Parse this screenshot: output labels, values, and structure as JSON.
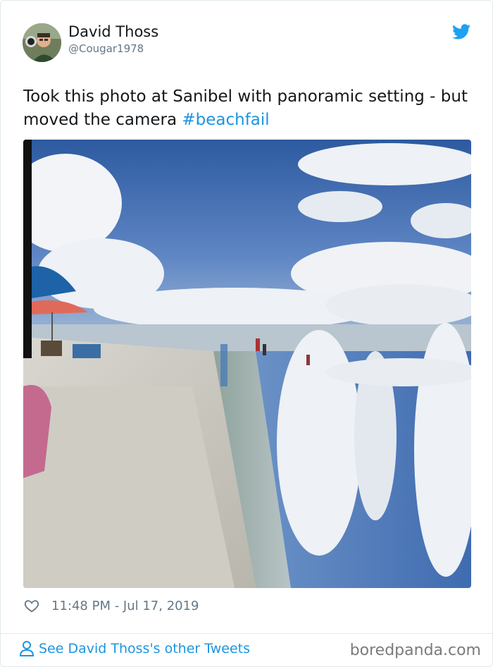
{
  "tweet": {
    "author_name": "David Thoss",
    "author_handle": "@Cougar1978",
    "text_plain": "Took this photo at Sanibel with panoramic setting - but moved the camera ",
    "hashtag": "#beachfail",
    "timestamp": "11:48 PM - Jul 17, 2019",
    "see_more": "See David Thoss's other Tweets"
  },
  "watermark": "boredpanda.com",
  "icons": {
    "bird": "twitter-bird-icon",
    "heart": "heart-icon",
    "user": "user-icon"
  },
  "colors": {
    "link": "#1b95e0",
    "muted": "#657786",
    "text": "#14171a",
    "border": "#e1e8ed"
  }
}
